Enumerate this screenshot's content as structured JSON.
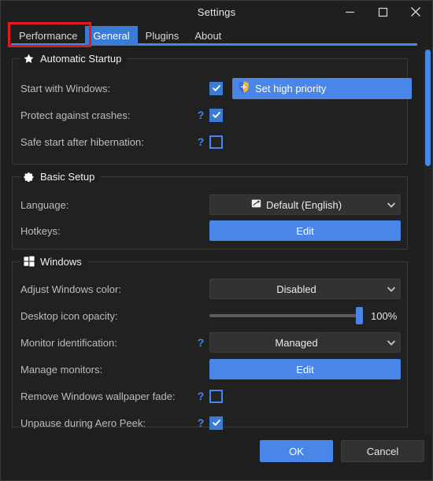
{
  "window": {
    "title": "Settings",
    "minimize_label": "Minimize",
    "maximize_label": "Maximize",
    "close_label": "Close"
  },
  "tabs": [
    {
      "label": "Performance",
      "active": false,
      "highlighted": true
    },
    {
      "label": "General",
      "active": true,
      "highlighted": false
    },
    {
      "label": "Plugins",
      "active": false,
      "highlighted": false
    },
    {
      "label": "About",
      "active": false,
      "highlighted": false
    }
  ],
  "groups": {
    "automatic_startup": {
      "title": "Automatic Startup",
      "icon": "star-icon",
      "rows": {
        "start_with_windows": {
          "label": "Start with Windows:",
          "checkbox_checked": true,
          "button_label": "Set high priority",
          "button_icon": "uac-shield-icon"
        },
        "protect_against_crashes": {
          "label": "Protect against crashes:",
          "help": "?",
          "checkbox_checked": true
        },
        "safe_start_after_hibernation": {
          "label": "Safe start after hibernation:",
          "help": "?",
          "checkbox_checked": false
        }
      }
    },
    "basic_setup": {
      "title": "Basic Setup",
      "icon": "gear-icon",
      "rows": {
        "language": {
          "label": "Language:",
          "value": "Default (English)",
          "value_icon": "language-flag-icon"
        },
        "hotkeys": {
          "label": "Hotkeys:",
          "button_label": "Edit"
        }
      }
    },
    "windows": {
      "title": "Windows",
      "icon": "windows-logo-icon",
      "rows": {
        "adjust_windows_color": {
          "label": "Adjust Windows color:",
          "value": "Disabled"
        },
        "desktop_icon_opacity": {
          "label": "Desktop icon opacity:",
          "value": "100%",
          "percent": 100
        },
        "monitor_identification": {
          "label": "Monitor identification:",
          "help": "?",
          "value": "Managed"
        },
        "manage_monitors": {
          "label": "Manage monitors:",
          "button_label": "Edit"
        },
        "remove_wallpaper_fade": {
          "label": "Remove Windows wallpaper fade:",
          "help": "?",
          "checkbox_checked": false
        },
        "unpause_aero_peek": {
          "label": "Unpause during Aero Peek:",
          "help": "?",
          "checkbox_checked": true
        }
      }
    }
  },
  "footer": {
    "ok_label": "OK",
    "cancel_label": "Cancel"
  },
  "colors": {
    "accent": "#4a86e8",
    "accent_tab": "#3c7bd4",
    "annotation": "#e01b1b",
    "window_bg": "#1f1f1f",
    "group_bg": "#212121",
    "field_bg": "#323232"
  }
}
